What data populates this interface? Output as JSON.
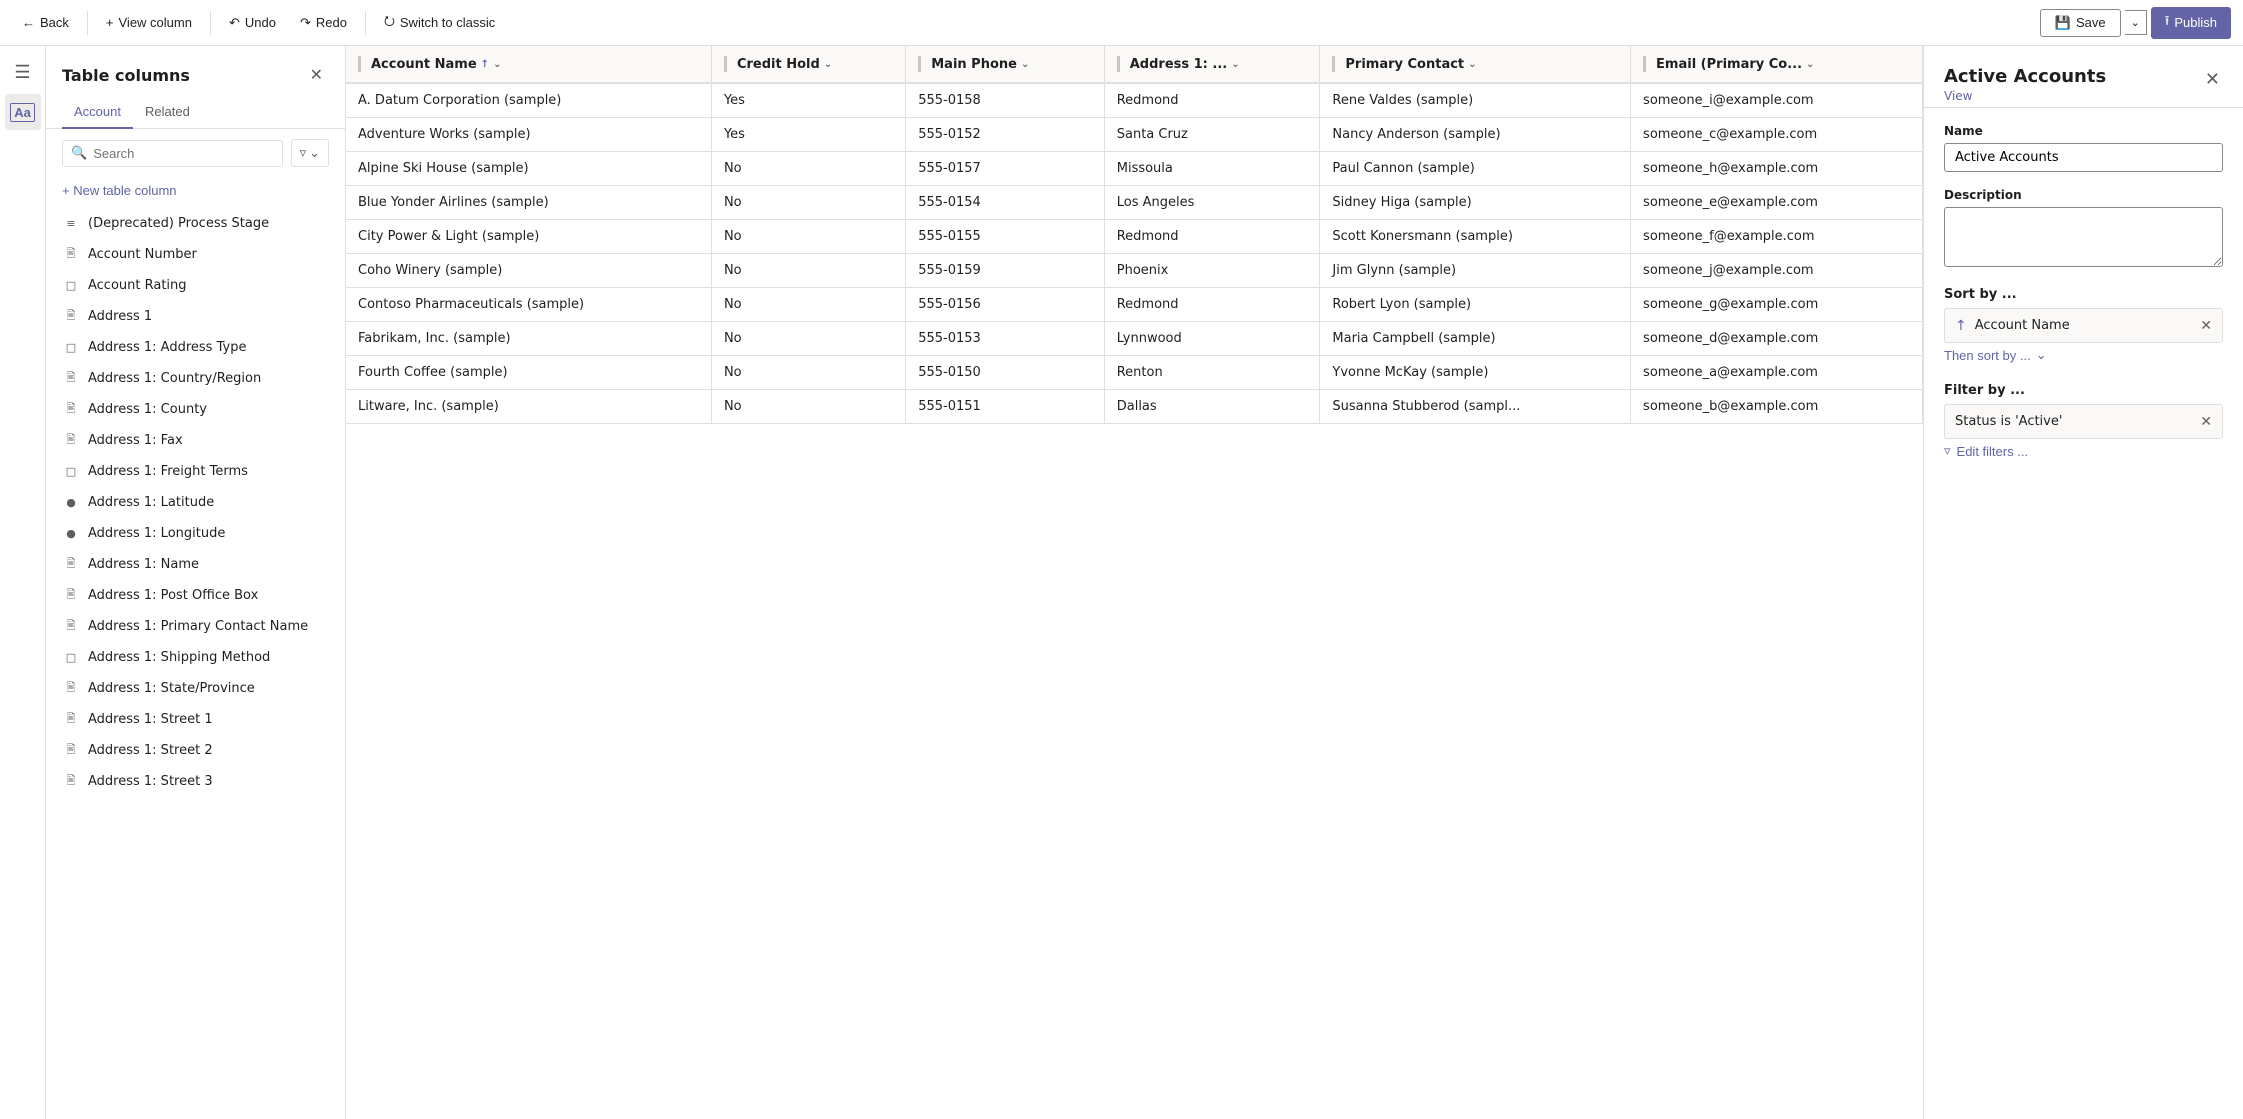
{
  "toolbar": {
    "back_label": "Back",
    "view_column_label": "View column",
    "undo_label": "Undo",
    "redo_label": "Redo",
    "switch_label": "Switch to classic",
    "save_label": "Save",
    "publish_label": "Publish"
  },
  "columns_panel": {
    "title": "Table columns",
    "close_icon": "✕",
    "tabs": [
      "Account",
      "Related"
    ],
    "active_tab": 0,
    "search_placeholder": "Search",
    "new_column_label": "+ New table column",
    "columns": [
      {
        "name": "(Deprecated) Process Stage",
        "icon": "list"
      },
      {
        "name": "Account Number",
        "icon": "text"
      },
      {
        "name": "Account Rating",
        "icon": "box"
      },
      {
        "name": "Address 1",
        "icon": "text"
      },
      {
        "name": "Address 1: Address Type",
        "icon": "box"
      },
      {
        "name": "Address 1: Country/Region",
        "icon": "text"
      },
      {
        "name": "Address 1: County",
        "icon": "text"
      },
      {
        "name": "Address 1: Fax",
        "icon": "text"
      },
      {
        "name": "Address 1: Freight Terms",
        "icon": "box"
      },
      {
        "name": "Address 1: Latitude",
        "icon": "circle"
      },
      {
        "name": "Address 1: Longitude",
        "icon": "circle"
      },
      {
        "name": "Address 1: Name",
        "icon": "text"
      },
      {
        "name": "Address 1: Post Office Box",
        "icon": "text"
      },
      {
        "name": "Address 1: Primary Contact Name",
        "icon": "text"
      },
      {
        "name": "Address 1: Shipping Method",
        "icon": "box"
      },
      {
        "name": "Address 1: State/Province",
        "icon": "text"
      },
      {
        "name": "Address 1: Street 1",
        "icon": "text"
      },
      {
        "name": "Address 1: Street 2",
        "icon": "text"
      },
      {
        "name": "Address 1: Street 3",
        "icon": "text"
      }
    ]
  },
  "grid": {
    "columns": [
      {
        "label": "Account Name",
        "sort": "asc",
        "has_caret": true
      },
      {
        "label": "Credit Hold",
        "sort": null,
        "has_caret": true
      },
      {
        "label": "Main Phone",
        "sort": null,
        "has_caret": true
      },
      {
        "label": "Address 1: ...",
        "sort": null,
        "has_caret": true
      },
      {
        "label": "Primary Contact",
        "sort": null,
        "has_caret": true
      },
      {
        "label": "Email (Primary Co...",
        "sort": null,
        "has_caret": true
      }
    ],
    "rows": [
      [
        "A. Datum Corporation (sample)",
        "Yes",
        "555-0158",
        "Redmond",
        "Rene Valdes (sample)",
        "someone_i@example.com"
      ],
      [
        "Adventure Works (sample)",
        "Yes",
        "555-0152",
        "Santa Cruz",
        "Nancy Anderson (sample)",
        "someone_c@example.com"
      ],
      [
        "Alpine Ski House (sample)",
        "No",
        "555-0157",
        "Missoula",
        "Paul Cannon (sample)",
        "someone_h@example.com"
      ],
      [
        "Blue Yonder Airlines (sample)",
        "No",
        "555-0154",
        "Los Angeles",
        "Sidney Higa (sample)",
        "someone_e@example.com"
      ],
      [
        "City Power & Light (sample)",
        "No",
        "555-0155",
        "Redmond",
        "Scott Konersmann (sample)",
        "someone_f@example.com"
      ],
      [
        "Coho Winery (sample)",
        "No",
        "555-0159",
        "Phoenix",
        "Jim Glynn (sample)",
        "someone_j@example.com"
      ],
      [
        "Contoso Pharmaceuticals (sample)",
        "No",
        "555-0156",
        "Redmond",
        "Robert Lyon (sample)",
        "someone_g@example.com"
      ],
      [
        "Fabrikam, Inc. (sample)",
        "No",
        "555-0153",
        "Lynnwood",
        "Maria Campbell (sample)",
        "someone_d@example.com"
      ],
      [
        "Fourth Coffee (sample)",
        "No",
        "555-0150",
        "Renton",
        "Yvonne McKay (sample)",
        "someone_a@example.com"
      ],
      [
        "Litware, Inc. (sample)",
        "No",
        "555-0151",
        "Dallas",
        "Susanna Stubberod (sampl...",
        "someone_b@example.com"
      ]
    ]
  },
  "right_panel": {
    "title": "Active Accounts",
    "subtitle": "View",
    "close_icon": "✕",
    "name_label": "Name",
    "name_value": "Active Accounts",
    "description_label": "Description",
    "description_placeholder": "",
    "sort_label": "Sort by ...",
    "sort_value": "Account Name",
    "sort_up_icon": "↑",
    "sort_remove_icon": "✕",
    "then_sort_label": "Then sort by ...",
    "filter_label": "Filter by ...",
    "filter_value": "Status is 'Active'",
    "filter_remove_icon": "✕",
    "edit_filters_label": "Edit filters ..."
  },
  "icon_bar": {
    "menu_icon": "☰",
    "text_icon": "Aa"
  }
}
